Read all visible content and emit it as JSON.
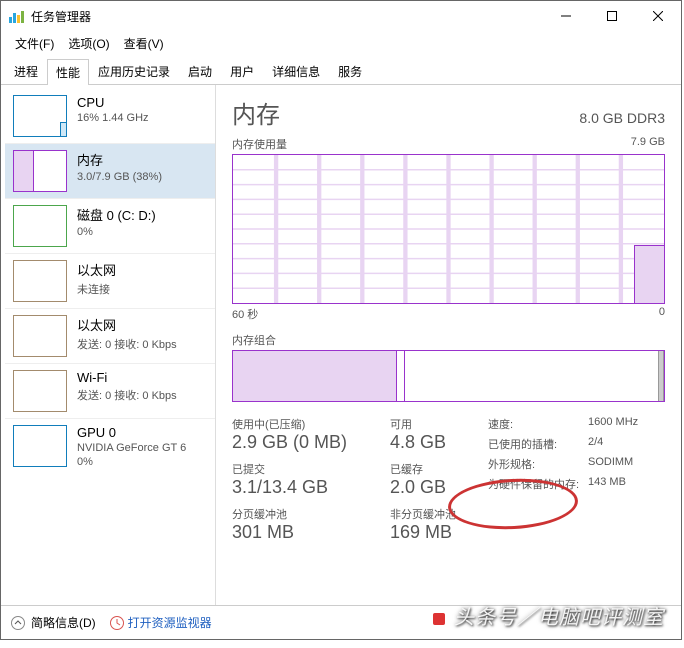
{
  "window": {
    "title": "任务管理器"
  },
  "menu": {
    "file": "文件(F)",
    "options": "选项(O)",
    "view": "查看(V)"
  },
  "tabs": {
    "processes": "进程",
    "performance": "性能",
    "history": "应用历史记录",
    "startup": "启动",
    "users": "用户",
    "details": "详细信息",
    "services": "服务"
  },
  "sidebar": {
    "cpu": {
      "title": "CPU",
      "sub": "16% 1.44 GHz"
    },
    "memory": {
      "title": "内存",
      "sub": "3.0/7.9 GB (38%)"
    },
    "disk": {
      "title": "磁盘 0 (C: D:)",
      "sub": "0%"
    },
    "eth0": {
      "title": "以太网",
      "sub": "未连接"
    },
    "eth1": {
      "title": "以太网",
      "sub": "发送: 0 接收: 0 Kbps"
    },
    "wifi": {
      "title": "Wi-Fi",
      "sub": "发送: 0 接收: 0 Kbps"
    },
    "gpu": {
      "title": "GPU 0",
      "sub": "NVIDIA GeForce GT 6",
      "sub2": "0%"
    }
  },
  "main": {
    "title": "内存",
    "right_title": "8.0 GB DDR3",
    "usage_label": "内存使用量",
    "usage_max": "7.9 GB",
    "axis_left": "60 秒",
    "axis_right": "0",
    "comp_label": "内存组合",
    "in_use_lbl": "使用中(已压缩)",
    "in_use_val": "2.9 GB (0 MB)",
    "avail_lbl": "可用",
    "avail_val": "4.8 GB",
    "commit_lbl": "已提交",
    "commit_val": "3.1/13.4 GB",
    "cached_lbl": "已缓存",
    "cached_val": "2.0 GB",
    "paged_lbl": "分页缓冲池",
    "paged_val": "301 MB",
    "nonpaged_lbl": "非分页缓冲池",
    "nonpaged_val": "169 MB",
    "speed_lbl": "速度:",
    "speed_val": "1600 MHz",
    "slots_lbl": "已使用的插槽:",
    "slots_val": "2/4",
    "form_lbl": "外形规格:",
    "form_val": "SODIMM",
    "hw_lbl": "为硬件保留的内存:",
    "hw_val": "143 MB"
  },
  "footer": {
    "fewer": "简略信息(D)",
    "monitor": "打开资源监视器"
  },
  "watermark": "头条号／电脑吧评测室",
  "chart_data": {
    "type": "line",
    "title": "内存使用量",
    "xlabel": "60 秒 → 0",
    "ylabel": "GB",
    "ylim": [
      0,
      7.9
    ],
    "series": [
      {
        "name": "内存",
        "values": [
          0,
          0,
          0,
          0,
          0,
          0,
          0,
          0,
          0,
          0,
          0,
          0,
          0,
          0,
          0,
          0,
          0,
          0,
          0,
          0,
          0,
          0,
          0,
          0,
          3.0,
          3.0,
          3.0
        ]
      }
    ]
  }
}
